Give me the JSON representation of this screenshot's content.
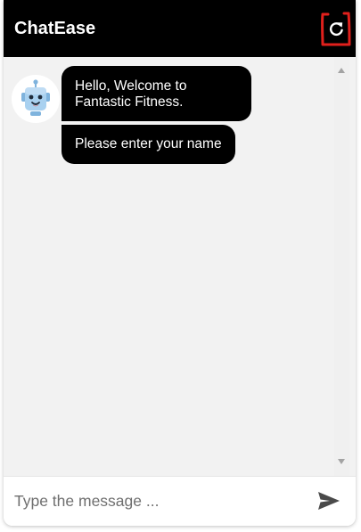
{
  "header": {
    "title": "ChatEase",
    "refresh_icon": "refresh-icon",
    "background": "#000000",
    "highlight_color": "#e0201c"
  },
  "messages": [
    {
      "sender": "bot",
      "text": "Hello, Welcome to Fantastic Fitness."
    },
    {
      "sender": "bot",
      "text": "Please enter your name"
    }
  ],
  "avatar": {
    "icon": "robot-icon"
  },
  "composer": {
    "placeholder": "Type the message ...",
    "value": "",
    "send_icon": "send-icon"
  }
}
